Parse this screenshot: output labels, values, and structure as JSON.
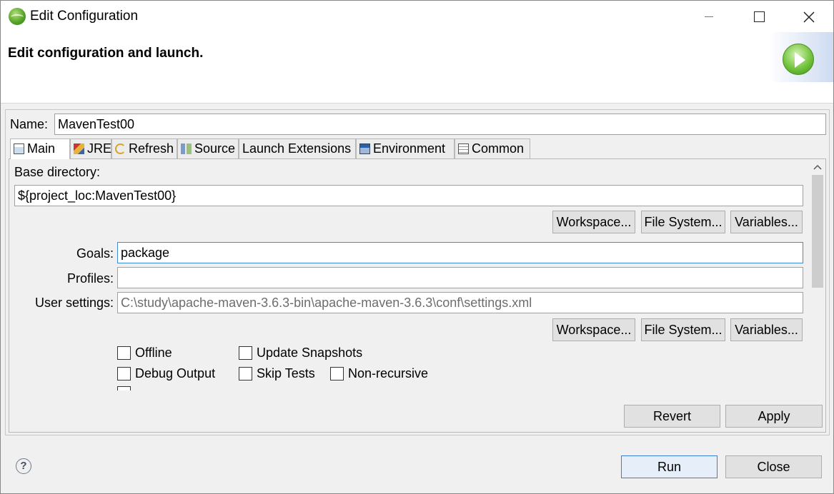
{
  "window": {
    "title": "Edit Configuration"
  },
  "banner": {
    "title": "Edit configuration and launch."
  },
  "name": {
    "label": "Name:",
    "value": "MavenTest00"
  },
  "tabs": [
    {
      "label": "Main",
      "icon": "main-tab-icon",
      "active": true
    },
    {
      "label": "JRE",
      "icon": "jre-icon"
    },
    {
      "label": "Refresh",
      "icon": "refresh-icon"
    },
    {
      "label": "Source",
      "icon": "source-icon"
    },
    {
      "label": "Launch Extensions",
      "icon": ""
    },
    {
      "label": "Environment",
      "icon": "environment-icon"
    },
    {
      "label": "Common",
      "icon": "common-icon"
    }
  ],
  "main": {
    "base_directory_label": "Base directory:",
    "base_directory_value": "${project_loc:MavenTest00}",
    "workspace_label": "Workspace...",
    "file_system_label": "File System...",
    "variables_label": "Variables...",
    "goals_label": "Goals:",
    "goals_value": "package",
    "profiles_label": "Profiles:",
    "profiles_value": "",
    "user_settings_label": "User settings:",
    "user_settings_value": "C:\\study\\apache-maven-3.6.3-bin\\apache-maven-3.6.3\\conf\\settings.xml",
    "checkboxes": {
      "offline": "Offline",
      "update_snapshots": "Update Snapshots",
      "debug_output": "Debug Output",
      "skip_tests": "Skip Tests",
      "non_recursive": "Non-recursive"
    }
  },
  "actions": {
    "revert": "Revert",
    "apply": "Apply",
    "run": "Run",
    "close": "Close"
  },
  "help": {
    "symbol": "?"
  }
}
